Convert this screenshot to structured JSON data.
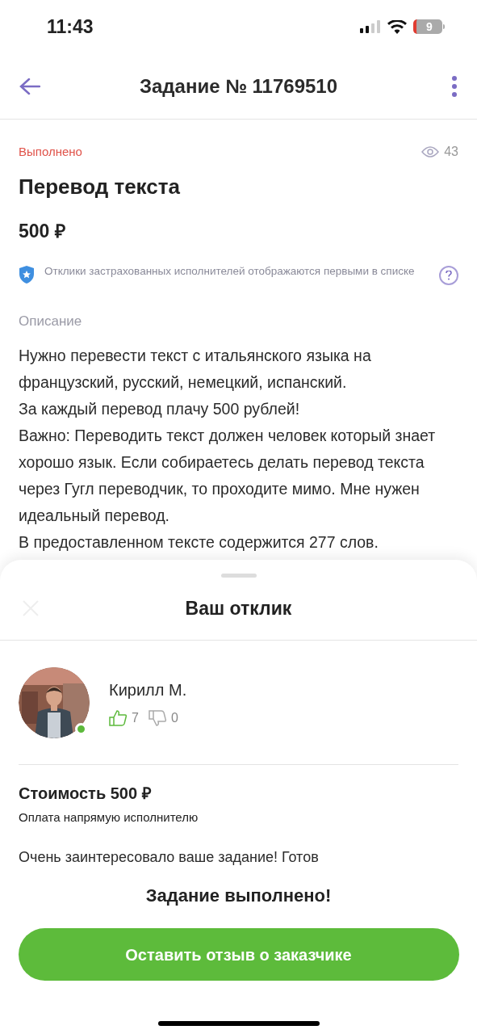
{
  "status_bar": {
    "time": "11:43",
    "battery": "9"
  },
  "header": {
    "title": "Задание № 11769510"
  },
  "task": {
    "status": "Выполнено",
    "views": "43",
    "title": "Перевод текста",
    "price": "500 ₽",
    "insurance_note": "Отклики застрахованных исполнителей отображаются первыми в списке",
    "description_label": "Описание",
    "description": [
      "Нужно перевести текст с итальянского языка на французский, русский, немецкий, испанский.",
      "За каждый перевод плачу 500 рублей!",
      "Важно: Переводить текст должен человек который знает хорошо язык. Если собираетесь делать перевод текста через Гугл переводчик, то проходите мимо. Мне нужен идеальный перевод.",
      "В предоставленном тексте содержится 277 слов."
    ]
  },
  "sheet": {
    "title": "Ваш отклик",
    "performer": {
      "name": "Кирилл М.",
      "online": true,
      "likes": "7",
      "dislikes": "0"
    },
    "cost": "Стоимость 500 ₽",
    "payment_note": "Оплата напрямую исполнителю",
    "message": "Очень заинтересовало ваше задание! Готов"
  },
  "footer": {
    "status": "Задание выполнено!",
    "button": "Оставить отзыв о заказчике"
  }
}
